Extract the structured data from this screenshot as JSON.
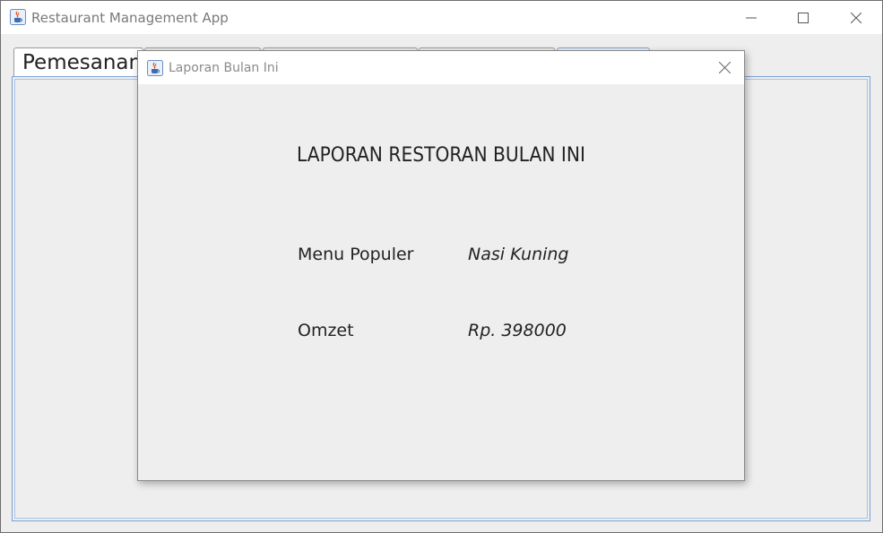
{
  "window": {
    "title": "Restaurant Management App",
    "icon": "java-cup-icon"
  },
  "tabs": [
    {
      "label": "Pemesanan",
      "active": true
    },
    {
      "label": "",
      "active": false
    },
    {
      "label": "",
      "active": false
    },
    {
      "label": "",
      "active": false
    },
    {
      "label": "",
      "active": false
    }
  ],
  "dialog": {
    "title": "Laporan Bulan Ini",
    "heading": "LAPORAN RESTORAN BULAN INI",
    "rows": [
      {
        "label": "Menu Populer",
        "value": "Nasi Kuning"
      },
      {
        "label": "Omzet",
        "value": "Rp. 398000"
      }
    ]
  },
  "colors": {
    "accent_border": "#7aa3d3",
    "background": "#eeeeee"
  }
}
